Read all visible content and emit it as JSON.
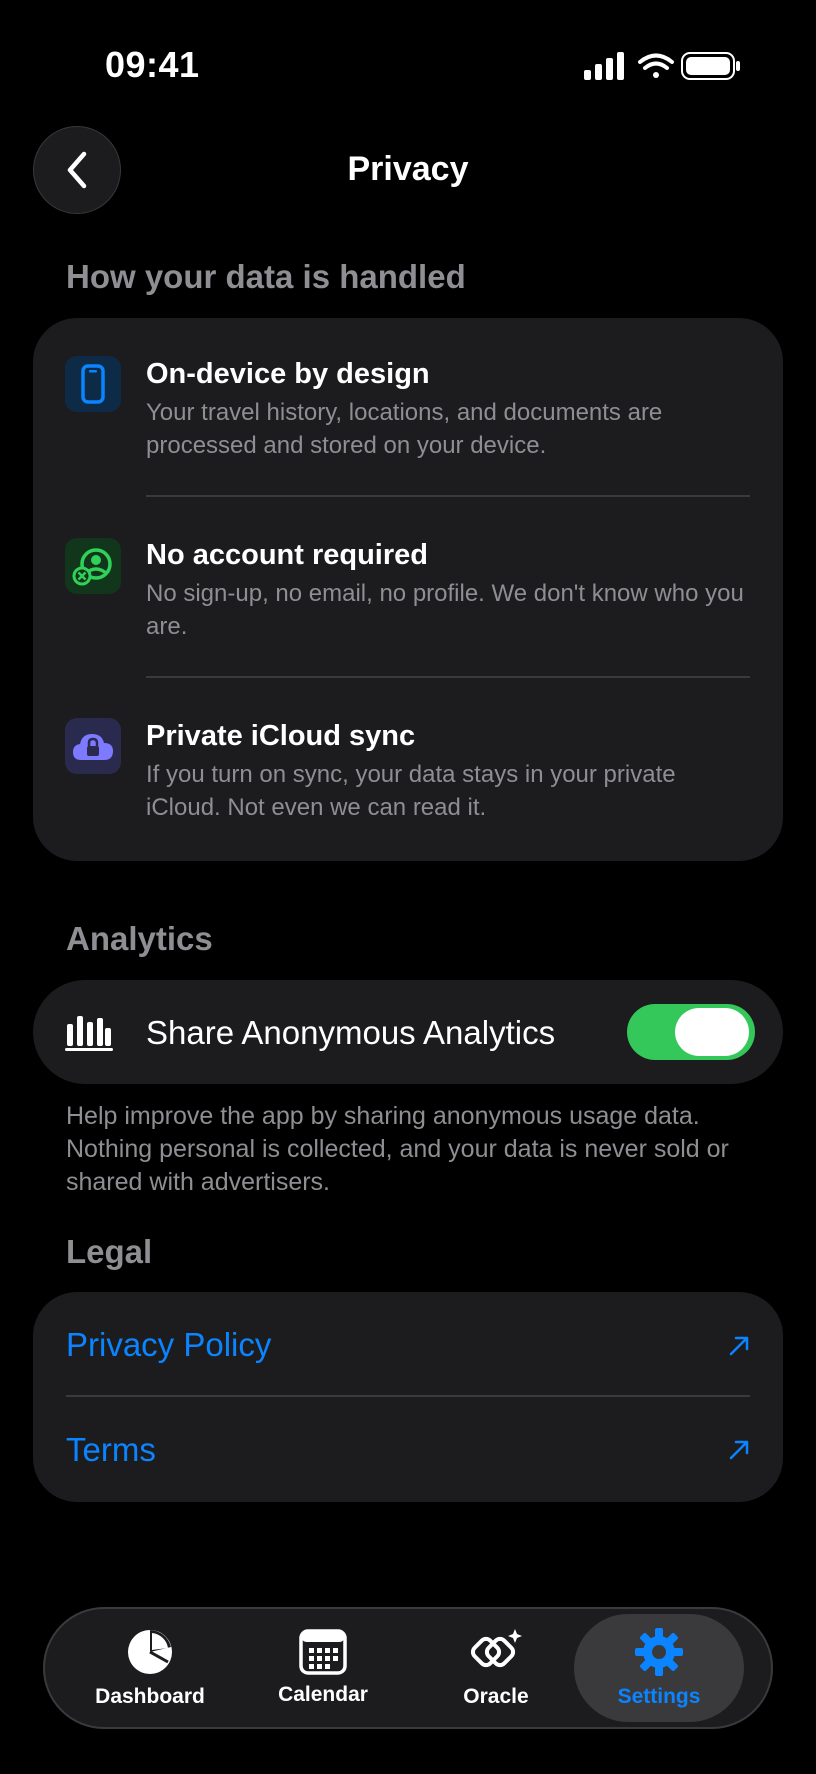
{
  "status": {
    "time": "09:41"
  },
  "nav": {
    "title": "Privacy"
  },
  "data_section": {
    "title": "How your data is handled",
    "items": [
      {
        "title": "On-device by design",
        "description": "Your travel history, locations, and documents are processed and stored on your device.",
        "icon": "phone-icon"
      },
      {
        "title": "No account required",
        "description": "No sign-up, no email, no profile. We don't know who you are.",
        "icon": "no-account-icon"
      },
      {
        "title": "Private iCloud sync",
        "description": "If you turn on sync, your data stays in your private iCloud. Not even we can read it.",
        "icon": "cloud-lock-icon"
      }
    ]
  },
  "analytics": {
    "title": "Analytics",
    "toggle_label": "Share Anonymous Analytics",
    "toggle_on": true,
    "help": "Help improve the app by sharing anonymous usage data. Nothing personal is collected, and your data is never sold or shared with advertisers."
  },
  "legal": {
    "title": "Legal",
    "links": [
      {
        "label": "Privacy Policy"
      },
      {
        "label": "Terms"
      }
    ]
  },
  "tabbar": {
    "tabs": [
      {
        "label": "Dashboard",
        "icon": "pie-chart-icon"
      },
      {
        "label": "Calendar",
        "icon": "calendar-icon"
      },
      {
        "label": "Oracle",
        "icon": "oracle-icon"
      },
      {
        "label": "Settings",
        "icon": "gear-icon",
        "active": true
      }
    ]
  },
  "colors": {
    "accent": "#0a84ff",
    "toggle_on": "#34c759",
    "card": "#1c1c1e"
  }
}
